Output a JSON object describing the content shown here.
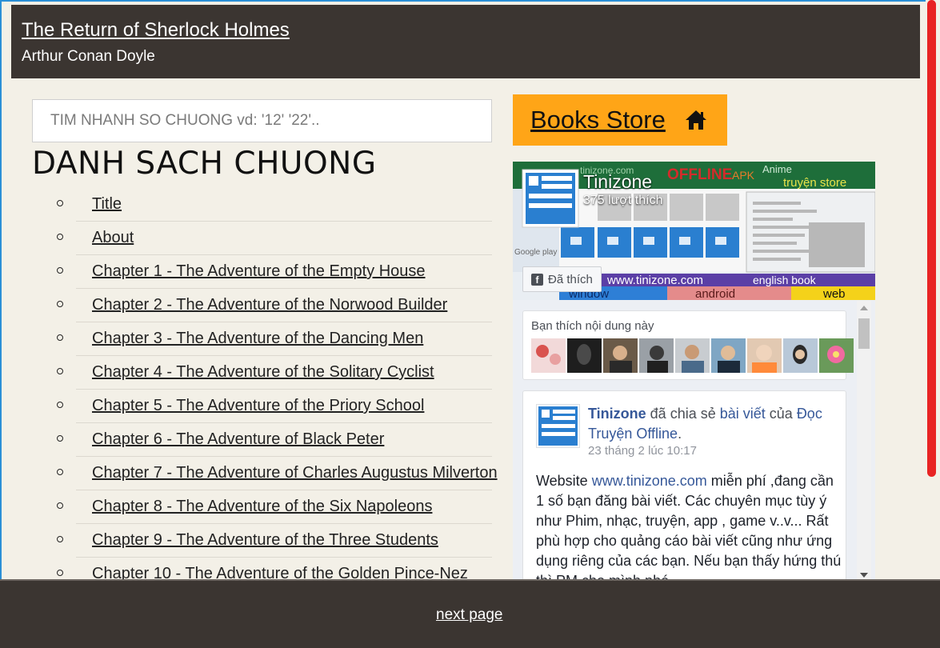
{
  "header": {
    "title": "The Return of Sherlock Holmes",
    "author": "Arthur Conan Doyle"
  },
  "search": {
    "placeholder": "TIM NHANH SO CHUONG vd: '12' '22'.."
  },
  "chapter_list": {
    "heading": "DANH SACH CHUONG",
    "items": [
      "Title",
      "About",
      "Chapter 1 - The Adventure of the Empty House",
      "Chapter 2 - The Adventure of the Norwood Builder",
      "Chapter 3 - The Adventure of the Dancing Men",
      "Chapter 4 - The Adventure of the Solitary Cyclist",
      "Chapter 5 - The Adventure of the Priory School",
      "Chapter 6 - The Adventure of Black Peter",
      "Chapter 7 - The Adventure of Charles Augustus Milverton",
      "Chapter 8 - The Adventure of the Six Napoleons",
      "Chapter 9 - The Adventure of the Three Students",
      "Chapter 10 - The Adventure of the Golden Pince-Nez"
    ]
  },
  "store": {
    "label": "Books Store",
    "icon": "home-icon"
  },
  "facebook": {
    "page_name": "Tinizone",
    "likes": "375 lượt thích",
    "like_button": "Đã thích",
    "cover_texts": {
      "site": "tinizone.com",
      "offline": "OFFLINE",
      "apk": "APK",
      "anime": "Anime",
      "store": "truyện store",
      "url": "www.tinizone.com",
      "english": "english book",
      "window": "window",
      "android": "android",
      "web": "web",
      "google_play": "Google play"
    },
    "friends_label": "Bạn thích nội dung này",
    "post": {
      "author": "Tinizone",
      "shared": " đã chia sẻ ",
      "post_link": "bài viết",
      "of": " của ",
      "page_link": "Đọc Truyện Offline",
      "period": ".",
      "time": "23 tháng 2 lúc 10:17",
      "body_prefix": "Website ",
      "body_link": "www.tinizone.com",
      "body_rest": " miễn phí ,đang cần 1 số bạn đăng bài viết. Các chuyên mục tùy ý như Phim, nhạc, truyện, app , game v..v... Rất phù hợp cho quảng cáo bài viết cũng như ứng dụng riêng của các bạn. Nếu bạn thấy hứng thú thì PM cho mình nhé."
    }
  },
  "footer": {
    "next_page": "next page"
  },
  "colors": {
    "header_bg": "#3b3531",
    "page_bg": "#f3f0e7",
    "store_button": "#ffa517",
    "scroll_thumb": "#e82424"
  }
}
